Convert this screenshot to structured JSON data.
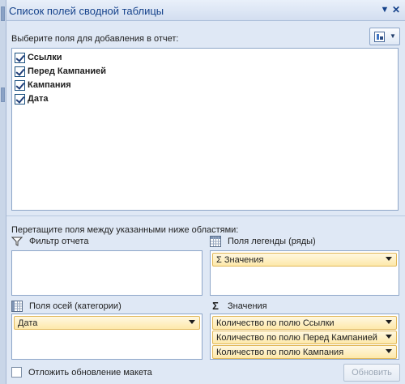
{
  "window": {
    "title": "Список полей сводной таблицы",
    "dropdown_icon": "chevron-down-icon",
    "close_icon": "close-icon"
  },
  "field_list": {
    "prompt": "Выберите поля для добавления в отчет:",
    "layout_button_icon": "field-list-layout-icon",
    "fields": [
      {
        "label": "Ссылки",
        "checked": true
      },
      {
        "label": "Перед Кампанией",
        "checked": true
      },
      {
        "label": "Кампания",
        "checked": true
      },
      {
        "label": "Дата",
        "checked": true
      }
    ]
  },
  "areas": {
    "drag_hint": "Перетащите поля между указанными ниже областями:",
    "report_filter": {
      "label": "Фильтр отчета",
      "icon": "filter-icon",
      "items": []
    },
    "legend_fields": {
      "label": "Поля легенды (ряды)",
      "icon": "legend-grid-icon",
      "items": [
        "Σ Значения"
      ]
    },
    "axis_fields": {
      "label": "Поля осей (категории)",
      "icon": "axis-grid-icon",
      "items": [
        "Дата"
      ]
    },
    "values": {
      "label": "Значения",
      "icon": "sigma-icon",
      "items": [
        "Количество по полю Ссылки",
        "Количество по полю Перед Кампанией",
        "Количество по полю Кампания"
      ]
    }
  },
  "footer": {
    "defer_label": "Отложить обновление макета",
    "defer_checked": false,
    "update_label": "Обновить",
    "update_enabled": false
  },
  "colors": {
    "title_text": "#15428b",
    "panel_bg": "#dfe8f5",
    "pill_bg": "#fde9aa",
    "pill_border": "#e1b85a"
  }
}
